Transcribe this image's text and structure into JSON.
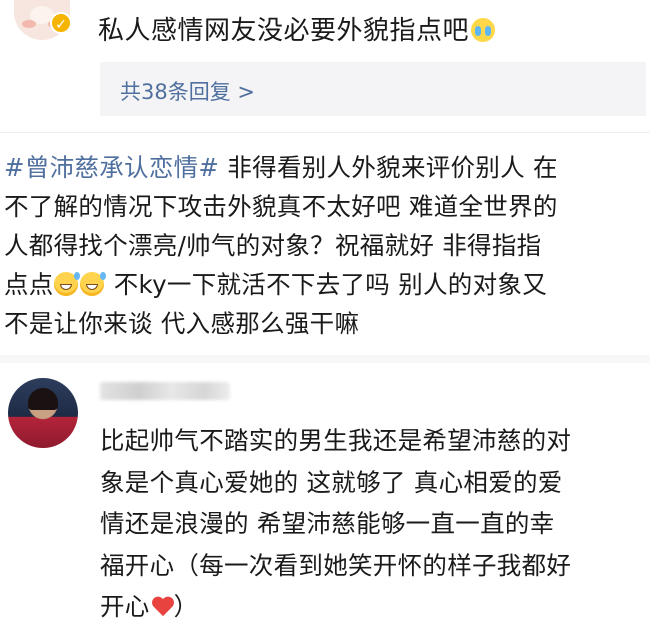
{
  "top_comment": {
    "text": "私人感情网友没必要外貌指点吧",
    "emoji": "crying-emoji",
    "badge_icon": "vip-badge-icon",
    "replies_link": "共38条回复 >"
  },
  "post": {
    "hashtag": "#曾沛慈承认恋情#",
    "lines": [
      " 非得看别人外貌来评价别人  在",
      "不了解的情况下攻击外貌真不太好吧 难道全世界的",
      "人都得找个漂亮/帅气的对象？祝福就好 非得指指",
      " 不ky一下就活不下去了吗 别人的对象又",
      "不是让你来谈 代入感那么强干嘛"
    ],
    "line4_prefix": "点点",
    "emoji": "grinning-sweat-emoji"
  },
  "reply": {
    "lines": [
      "比起帅气不踏实的男生我还是希望沛慈的对",
      "象是个真心爱她的 这就够了 真心相爱的爱",
      "情还是浪漫的 希望沛慈能够一直一直的幸",
      "福开心（每一次看到她笑开怀的样子我都好",
      "开心"
    ],
    "closing": "）",
    "emoji": "red-heart-emoji"
  },
  "colors": {
    "link": "#4f6f9e",
    "text": "#1a1a1a",
    "reply_box_bg": "#f4f4f6"
  }
}
